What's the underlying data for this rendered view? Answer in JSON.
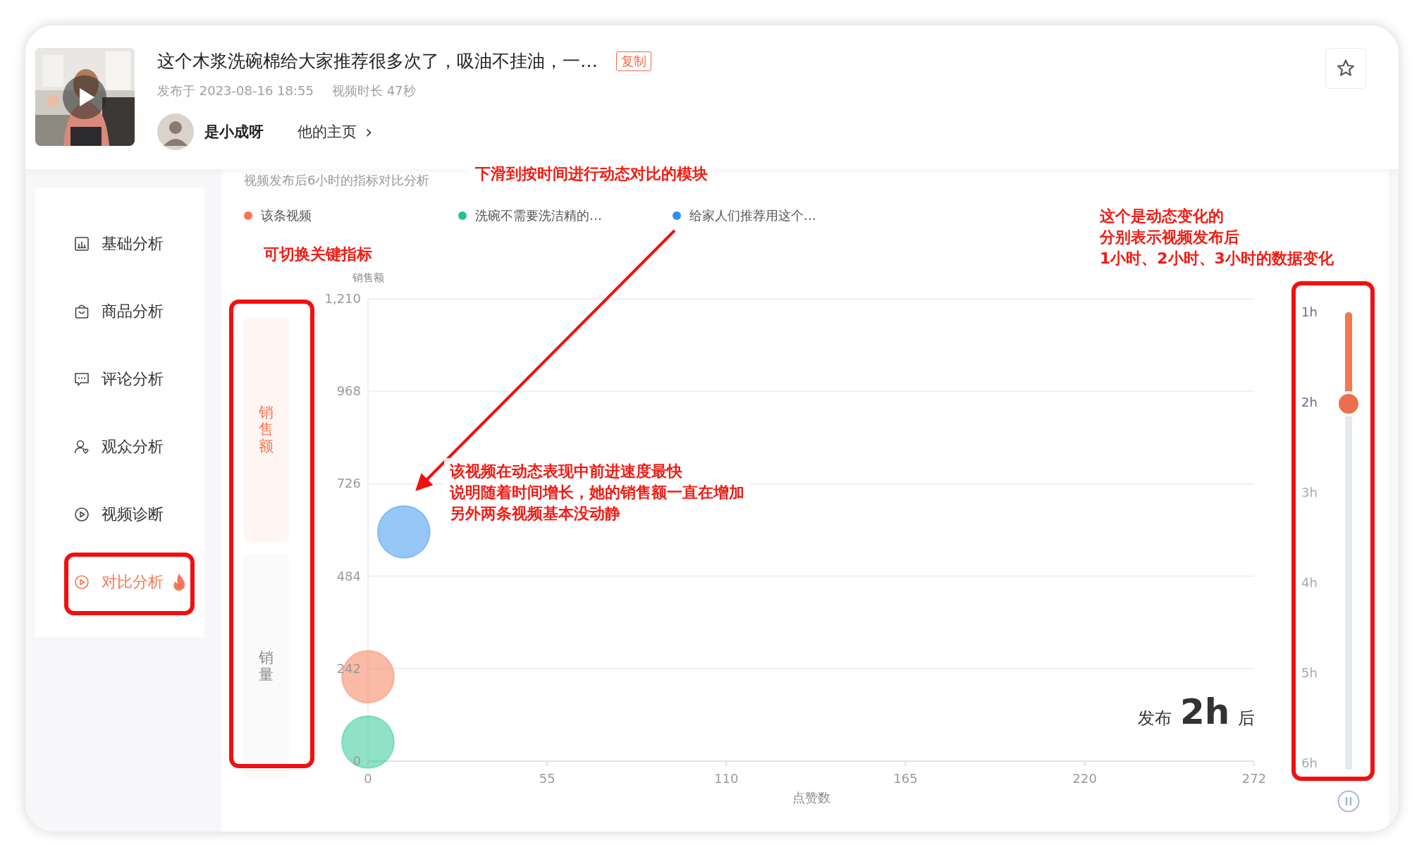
{
  "video": {
    "title": "这个木浆洗碗棉给大家推荐很多次了，吸油不挂油，一…",
    "copy_tag": "复制",
    "published": "发布于 2023-08-16 18:55",
    "duration": "视频时长 47秒",
    "author": "是小成呀",
    "homepage_link": "他的主页",
    "homepage_arrow": "›"
  },
  "sidebar": {
    "items": [
      {
        "label": "基础分析",
        "selected": false,
        "hot": false
      },
      {
        "label": "商品分析",
        "selected": false,
        "hot": false
      },
      {
        "label": "评论分析",
        "selected": false,
        "hot": false
      },
      {
        "label": "观众分析",
        "selected": false,
        "hot": false
      },
      {
        "label": "视频诊断",
        "selected": false,
        "hot": false
      },
      {
        "label": "对比分析",
        "selected": true,
        "hot": true
      }
    ]
  },
  "panel": {
    "subtitle": "视频发布后6小时的指标对比分析",
    "metrics": [
      {
        "label": "销售额",
        "selected": true
      },
      {
        "label": "销量",
        "selected": false
      }
    ],
    "chart_data": {
      "type": "scatter",
      "grid": true,
      "xlabel": "点赞数",
      "ylabel": "销售额",
      "x": [
        0,
        11
      ],
      "series": [
        {
          "name": "该条视频",
          "color": "#f7764e",
          "values": [
            221,
            null
          ]
        },
        {
          "name": "洗碗不需要洗洁精的…",
          "color": "#1fc68b",
          "values": [
            50,
            null
          ]
        },
        {
          "name": "给家人们推荐用这个…",
          "color": "#2f8ff0",
          "values": [
            null,
            600
          ]
        }
      ],
      "xlim": [
        0,
        272
      ],
      "ylim": [
        0,
        1210
      ],
      "xticks": [
        0,
        55,
        110,
        165,
        220,
        272
      ],
      "yticks": [
        0,
        {
          "value": 242,
          "label": "242"
        },
        {
          "value": 484,
          "label": "484"
        },
        {
          "value": 726,
          "label": "726"
        },
        {
          "value": 968,
          "label": "968"
        },
        {
          "value": 1210,
          "label": "1,210"
        }
      ]
    },
    "elapsed": {
      "prefix": "发布",
      "value": "2h",
      "suffix": "后"
    },
    "timeline": {
      "ticks": [
        "1h",
        "2h",
        "3h",
        "4h",
        "5h",
        "6h"
      ],
      "level": 0.2
    }
  },
  "annotations": [
    {
      "kind": "note",
      "lines": [
        "下滑到按时间进行动态对比的模块"
      ]
    },
    {
      "kind": "note",
      "lines": [
        "可切换关键指标"
      ]
    },
    {
      "kind": "note",
      "lines": [
        "该视频在动态表现中前进速度最快",
        "说明随着时间增长，她的销售额一直在增加",
        "另外两条视频基本没动静"
      ]
    },
    {
      "kind": "note",
      "lines": [
        "这个是动态变化的",
        "分别表示视频发布后",
        "1小时、2小时、3小时的数据变化"
      ]
    }
  ]
}
